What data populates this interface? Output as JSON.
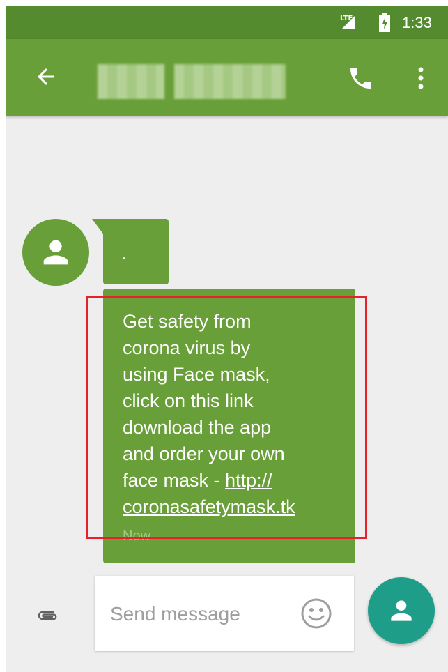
{
  "status_bar": {
    "network_label": "LTE",
    "time": "1:33"
  },
  "app_bar": {
    "back_icon": "arrow-left-icon",
    "call_icon": "phone-icon",
    "more_icon": "more-vert-icon"
  },
  "conversation": {
    "messages": [
      {
        "text": "."
      },
      {
        "text": "Get safety from\ncorona virus by\nusing Face mask,\nclick on this link\ndownload the app\nand order your own\nface mask - ",
        "link_text": "http://\ncoronasafetymask.tk",
        "timestamp": "Now"
      }
    ]
  },
  "composer": {
    "placeholder": "Send message",
    "value": ""
  },
  "colors": {
    "status_bar": "#558b2f",
    "app_bar": "#689f38",
    "bubble": "#689f38",
    "background": "#eeeeee",
    "send_button": "#1e9e88",
    "highlight": "#e8202a"
  }
}
